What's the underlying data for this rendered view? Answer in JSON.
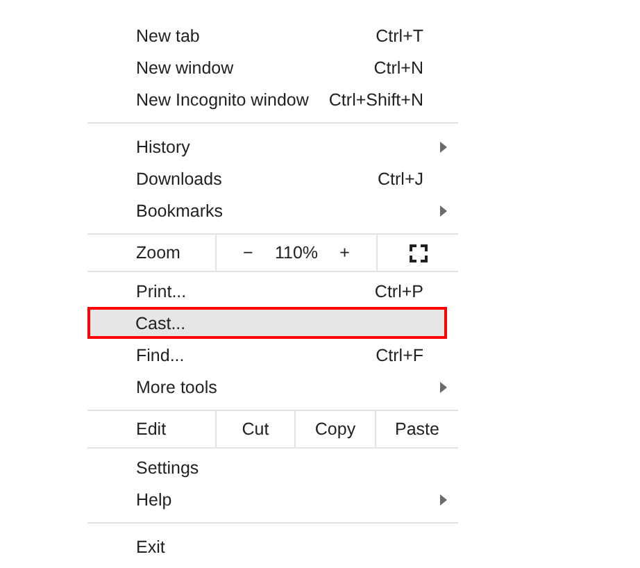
{
  "sections": [
    {
      "kind": "items",
      "items": [
        {
          "label": "New tab",
          "shortcut": "Ctrl+T",
          "submenu": false,
          "highlighted": false
        },
        {
          "label": "New window",
          "shortcut": "Ctrl+N",
          "submenu": false,
          "highlighted": false
        },
        {
          "label": "New Incognito window",
          "shortcut": "Ctrl+Shift+N",
          "submenu": false,
          "highlighted": false
        }
      ]
    },
    {
      "kind": "items",
      "items": [
        {
          "label": "History",
          "submenu": true,
          "highlighted": false
        },
        {
          "label": "Downloads",
          "shortcut": "Ctrl+J",
          "submenu": false,
          "highlighted": false
        },
        {
          "label": "Bookmarks",
          "submenu": true,
          "highlighted": false
        }
      ]
    },
    {
      "kind": "zoom",
      "label": "Zoom",
      "zoom_out": "−",
      "zoom_value": "110%",
      "zoom_in": "+"
    },
    {
      "kind": "items",
      "items": [
        {
          "label": "Print...",
          "shortcut": "Ctrl+P",
          "submenu": false,
          "highlighted": false
        },
        {
          "label": "Cast...",
          "submenu": false,
          "highlighted": true
        },
        {
          "label": "Find...",
          "shortcut": "Ctrl+F",
          "submenu": false,
          "highlighted": false
        },
        {
          "label": "More tools",
          "submenu": true,
          "highlighted": false
        }
      ]
    },
    {
      "kind": "edit",
      "label": "Edit",
      "buttons": [
        "Cut",
        "Copy",
        "Paste"
      ]
    },
    {
      "kind": "items",
      "items": [
        {
          "label": "Settings",
          "submenu": false,
          "highlighted": false
        },
        {
          "label": "Help",
          "submenu": true,
          "highlighted": false
        }
      ]
    },
    {
      "kind": "items",
      "items": [
        {
          "label": "Exit",
          "submenu": false,
          "highlighted": false
        }
      ]
    }
  ]
}
